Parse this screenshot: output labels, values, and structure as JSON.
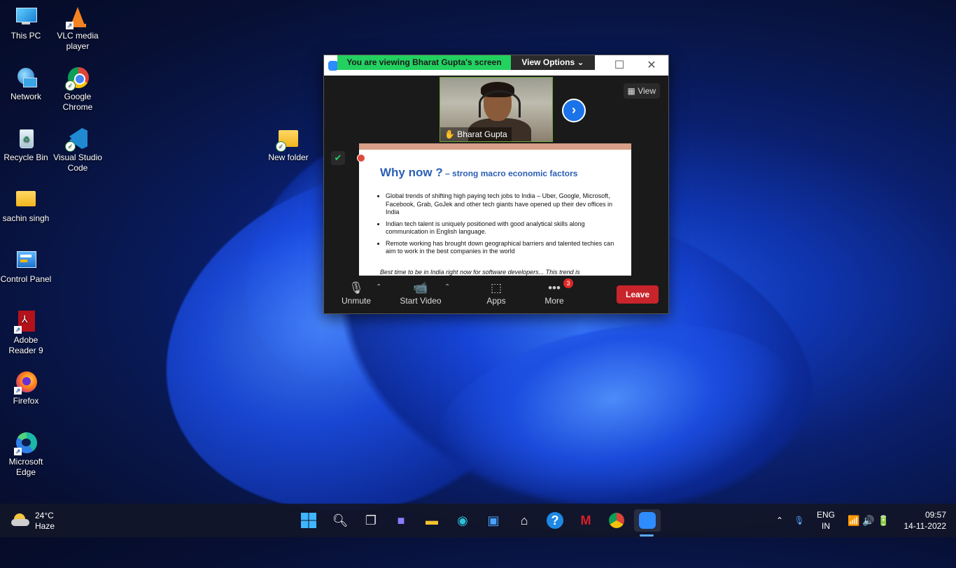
{
  "desktop": {
    "icons": [
      {
        "label": "This PC",
        "icon": "monitor-icon"
      },
      {
        "label": "VLC media player",
        "icon": "vlc-icon"
      },
      {
        "label": "Network",
        "icon": "network-icon"
      },
      {
        "label": "Google Chrome",
        "icon": "chrome-icon"
      },
      {
        "label": "Recycle Bin",
        "icon": "recycle-bin-icon"
      },
      {
        "label": "Visual Studio Code",
        "icon": "vscode-icon"
      },
      {
        "label": "New folder",
        "icon": "folder-icon"
      },
      {
        "label": "sachin singh",
        "icon": "folder-icon"
      },
      {
        "label": "Control Panel",
        "icon": "control-panel-icon"
      },
      {
        "label": "Adobe Reader 9",
        "icon": "adobe-reader-icon"
      },
      {
        "label": "Firefox",
        "icon": "firefox-icon"
      },
      {
        "label": "Microsoft Edge",
        "icon": "edge-icon"
      }
    ]
  },
  "zoom": {
    "banner": "You are viewing Bharat Gupta's screen",
    "view_options": "View Options",
    "view_button": "View",
    "participant_name": "Bharat Gupta",
    "slide": {
      "title": "Why now ?",
      "subtitle": " – strong macro economic factors",
      "bullets": [
        "Global trends of shifting high paying tech jobs to India – Uber, Google, Microsoft, Facebook, Grab, GoJek and other tech giants have opened up their dev offices in India",
        "Indian tech talent is uniquely positioned with good analytical skills along communication in English language.",
        "Remote working has brought down geographical barriers and talented techies can aim to work in the best companies in the world"
      ],
      "footer": "Best time to be in India right now for software developers... This trend is"
    },
    "controls": {
      "unmute": "Unmute",
      "start_video": "Start Video",
      "apps": "Apps",
      "more": "More",
      "more_badge": "3",
      "leave": "Leave"
    }
  },
  "taskbar": {
    "weather_temp": "24°C",
    "weather_desc": "Haze",
    "language": "ENG",
    "region": "IN",
    "time": "09:57",
    "date": "14-11-2022"
  }
}
